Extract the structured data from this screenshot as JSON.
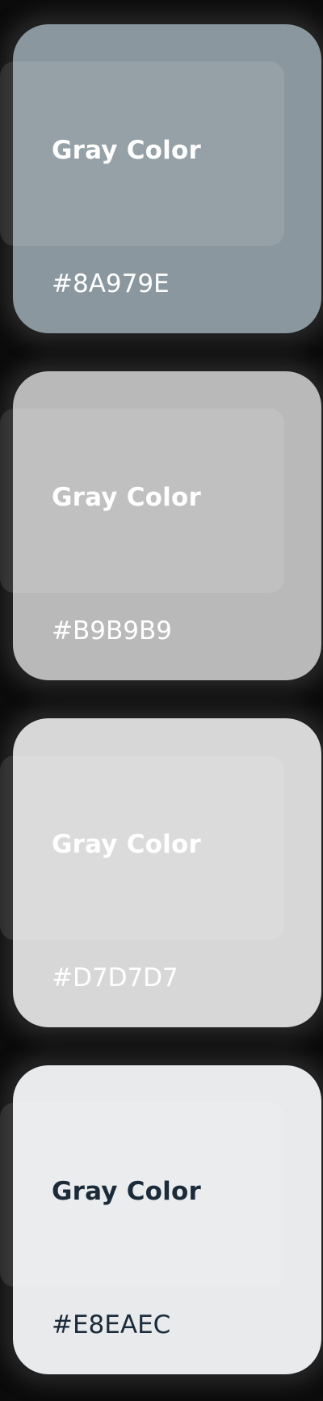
{
  "swatches": [
    {
      "title": "Gray Color",
      "hex": "#8A979E",
      "background": "#8A979E",
      "text_color": "#FFFFFF"
    },
    {
      "title": "Gray Color",
      "hex": "#B9B9B9",
      "background": "#B9B9B9",
      "text_color": "#FFFFFF"
    },
    {
      "title": "Gray Color",
      "hex": "#D7D7D7",
      "background": "#D7D7D7",
      "text_color": "#FFFFFF"
    },
    {
      "title": "Gray Color",
      "hex": "#E8EAEC",
      "background": "#E8EAEC",
      "text_color": "#1B2B3A"
    }
  ]
}
